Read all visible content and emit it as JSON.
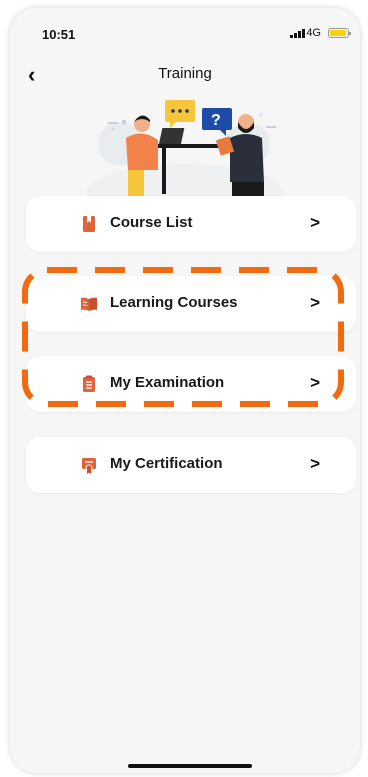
{
  "status": {
    "time": "10:51",
    "network": "4G"
  },
  "nav": {
    "title": "Training"
  },
  "menu": {
    "items": [
      {
        "label": "Course List",
        "icon": "book-icon"
      },
      {
        "label": "Learning Courses",
        "icon": "open-book-icon"
      },
      {
        "label": "My Examination",
        "icon": "clipboard-icon"
      },
      {
        "label": "My Certification",
        "icon": "certificate-icon"
      }
    ]
  },
  "colors": {
    "accent": "#f26a10",
    "icon": "#e0643a",
    "card": "#ffffff",
    "background": "#f6f6f6"
  }
}
